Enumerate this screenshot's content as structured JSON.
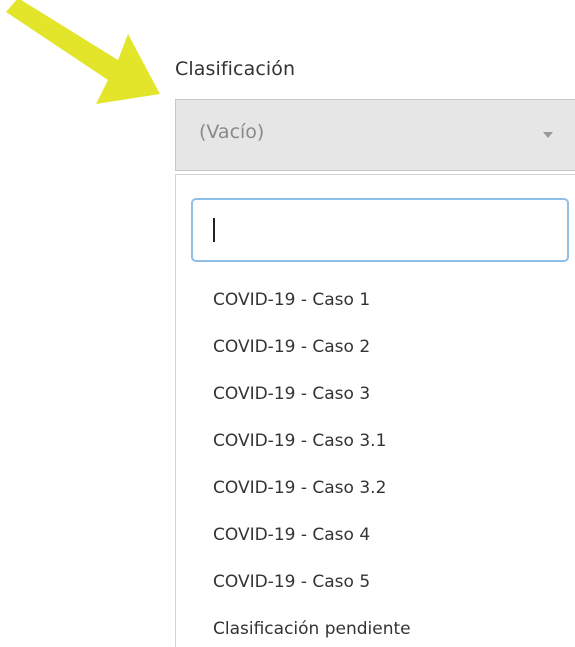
{
  "annotation": {
    "arrow_color": "#e3e52b"
  },
  "field": {
    "label": "Clasificación",
    "selected_value": "(Vacío)"
  },
  "dropdown": {
    "search_value": "",
    "options": [
      "COVID-19 - Caso 1",
      "COVID-19 - Caso 2",
      "COVID-19 - Caso 3",
      "COVID-19 - Caso 3.1",
      "COVID-19 - Caso 3.2",
      "COVID-19 - Caso 4",
      "COVID-19 - Caso 5",
      "Clasificación pendiente"
    ]
  },
  "colors": {
    "select_background": "#e6e6e6",
    "search_focus_border": "#8ec0ea"
  }
}
